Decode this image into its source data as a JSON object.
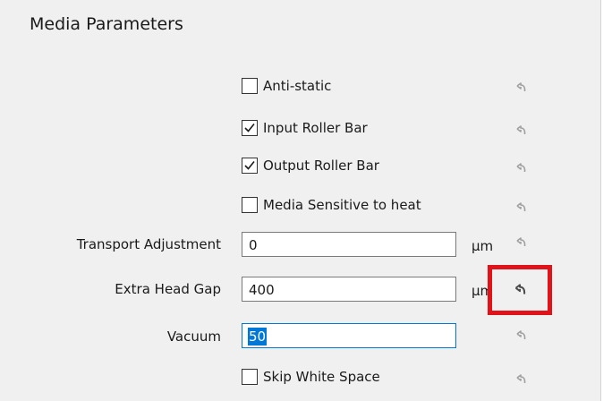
{
  "section_title": "Media Parameters",
  "checkboxes": [
    {
      "label": "Anti-static",
      "checked": false
    },
    {
      "label": "Input Roller Bar",
      "checked": true
    },
    {
      "label": "Output Roller Bar",
      "checked": true
    },
    {
      "label": "Media Sensitive to heat",
      "checked": false
    }
  ],
  "fields": {
    "transport_adjustment": {
      "label": "Transport Adjustment",
      "value": "0",
      "unit": "µm"
    },
    "extra_head_gap": {
      "label": "Extra Head Gap",
      "value": "400",
      "unit": "µm"
    },
    "vacuum": {
      "label": "Vacuum",
      "value": "50"
    }
  },
  "skip_white_space": {
    "label": "Skip White Space",
    "checked": false
  },
  "reset_icon": "undo-arrow-icon",
  "colors": {
    "highlight": "#e0131b",
    "focus": "#0078d7",
    "selection": "#0078d7",
    "reset_icon": "#a0a0a0",
    "reset_icon_active": "#4a4a4a"
  }
}
